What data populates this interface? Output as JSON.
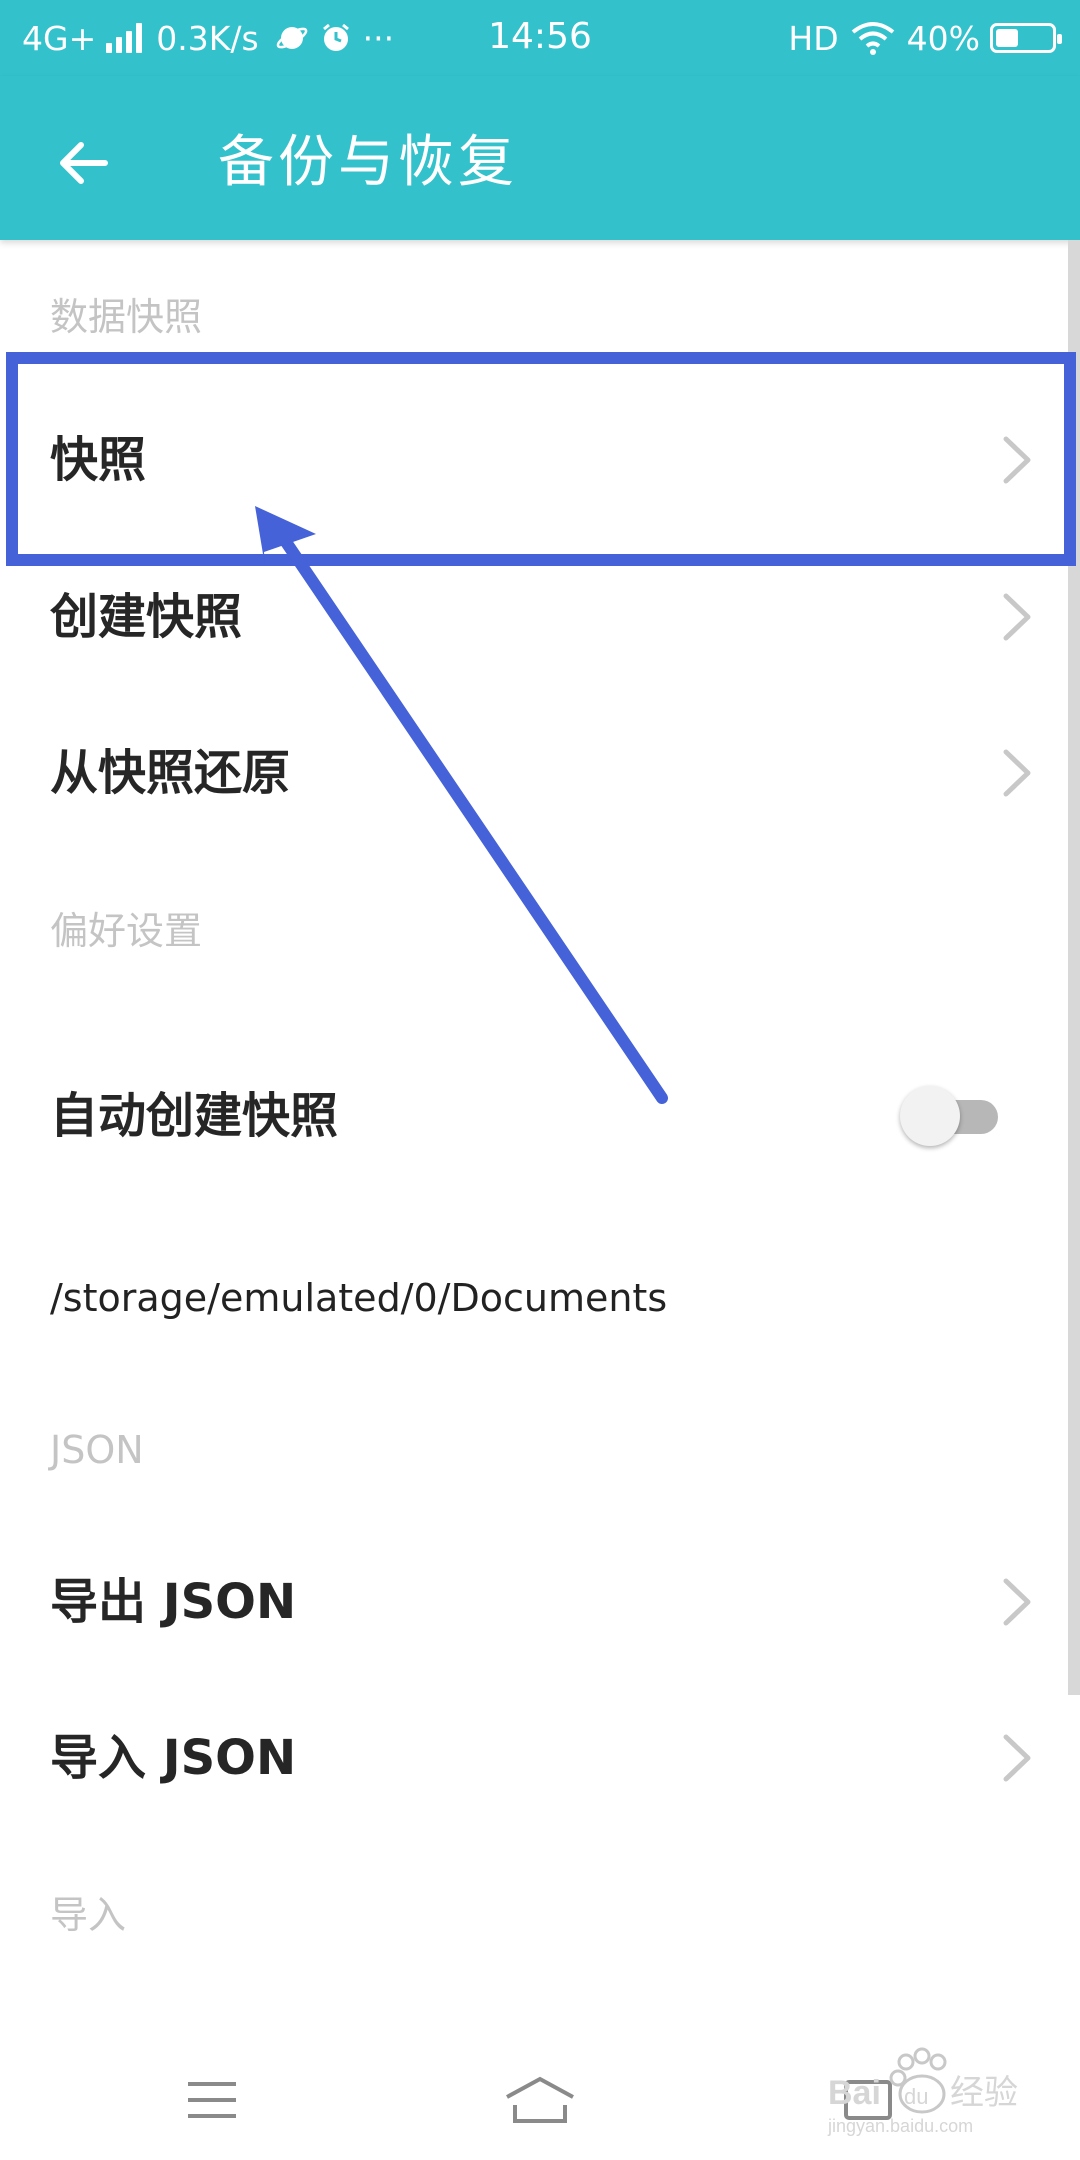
{
  "status_bar": {
    "network": "4G+",
    "speed": "0.3K/s",
    "more": "···",
    "time": "14:56",
    "hd": "HD",
    "battery": "40%",
    "battery_level": 0.4
  },
  "app_bar": {
    "title": "备份与恢复",
    "back_icon": "arrow-left-icon"
  },
  "sections": {
    "snapshot_header": "数据快照",
    "preferences_header": "偏好设置",
    "json_header": "JSON",
    "import_header": "导入"
  },
  "items": {
    "snapshot": "快照",
    "create_snapshot": "创建快照",
    "restore_snapshot": "从快照还原",
    "auto_create_snapshot": "自动创建快照",
    "storage_path": "/storage/emulated/0/Documents",
    "export_json": "导出 JSON",
    "import_json": "导入 JSON"
  },
  "toggle": {
    "auto_create_enabled": false
  },
  "annotation": {
    "color": "#4562d8"
  },
  "watermark": {
    "text": "Bai du 经验",
    "url": "jingyan.baidu.com"
  },
  "colors": {
    "accent": "#33c2cc",
    "section_header": "#c4c4c4",
    "chevron": "#c8c8c8"
  }
}
